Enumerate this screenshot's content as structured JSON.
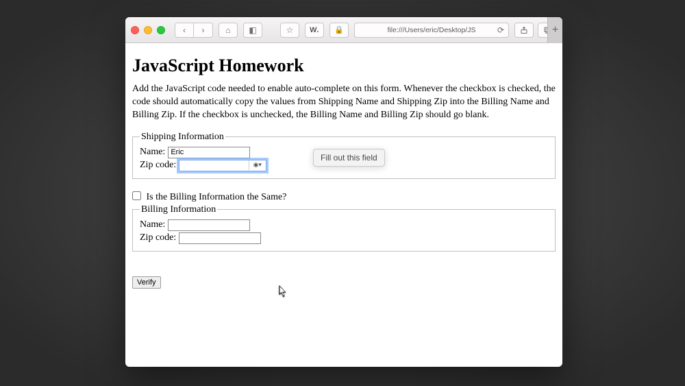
{
  "browser": {
    "address": "file:///Users/eric/Desktop/JS",
    "bookmark_w": "W."
  },
  "page": {
    "title": "JavaScript Homework",
    "intro": "Add the JavaScript code needed to enable auto-complete on this form. Whenever the checkbox is checked, the code should automatically copy the values from Shipping Name and Shipping Zip into the Billing Name and Billing Zip. If the checkbox is unchecked, the Billing Name and Billing Zip should go blank.",
    "shipping": {
      "legend": "Shipping Information",
      "name_label": "Name:",
      "name_value": "Eric",
      "zip_label": "Zip code:",
      "zip_value": ""
    },
    "same_checkbox_label": "Is the Billing Information the Same?",
    "billing": {
      "legend": "Billing Information",
      "name_label": "Name:",
      "name_value": "",
      "zip_label": "Zip code:",
      "zip_value": ""
    },
    "verify_label": "Verify"
  },
  "tooltip": "Fill out this field"
}
